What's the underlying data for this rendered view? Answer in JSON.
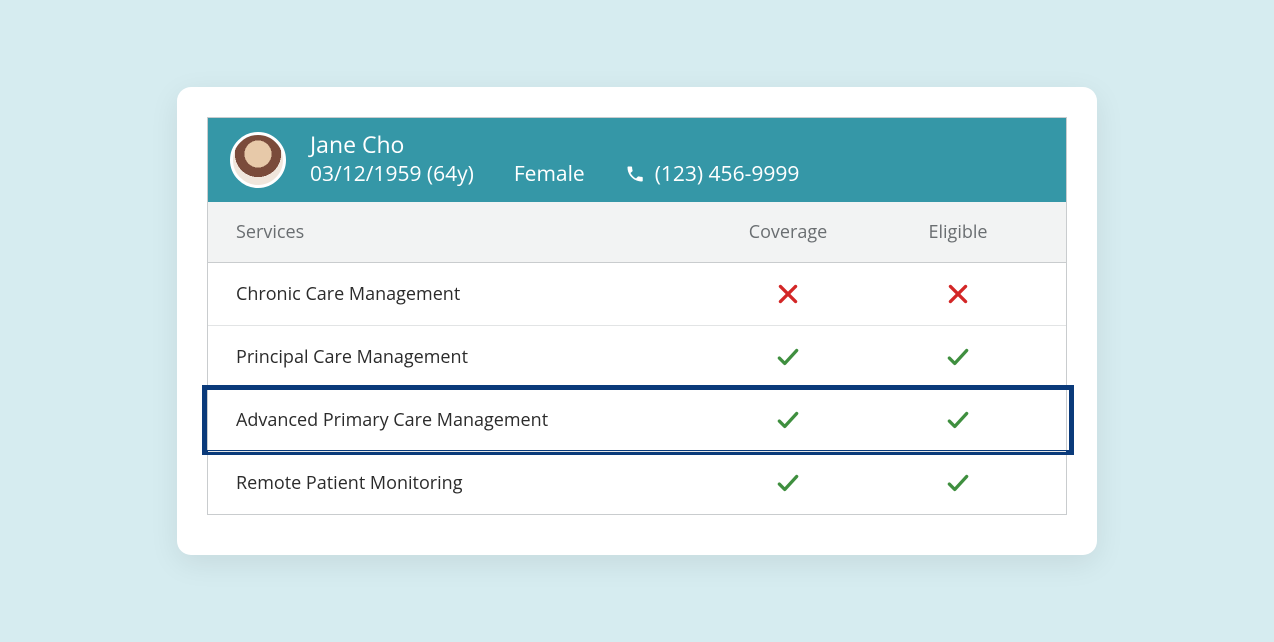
{
  "patient": {
    "name": "Jane Cho",
    "dob_age": "03/12/1959 (64y)",
    "gender": "Female",
    "phone": "(123) 456-9999"
  },
  "table": {
    "headers": {
      "services": "Services",
      "coverage": "Coverage",
      "eligible": "Eligible"
    },
    "rows": [
      {
        "service": "Chronic Care Management",
        "coverage": "x",
        "eligible": "x",
        "highlight": false
      },
      {
        "service": "Principal Care Management",
        "coverage": "check",
        "eligible": "check",
        "highlight": false
      },
      {
        "service": "Advanced Primary Care Management",
        "coverage": "check",
        "eligible": "check",
        "highlight": true
      },
      {
        "service": "Remote Patient Monitoring",
        "coverage": "check",
        "eligible": "check",
        "highlight": false
      }
    ]
  },
  "colors": {
    "header_bg": "#3597a7",
    "highlight_border": "#0a3a7a",
    "check": "#3f8f3f",
    "cross": "#d32626"
  }
}
